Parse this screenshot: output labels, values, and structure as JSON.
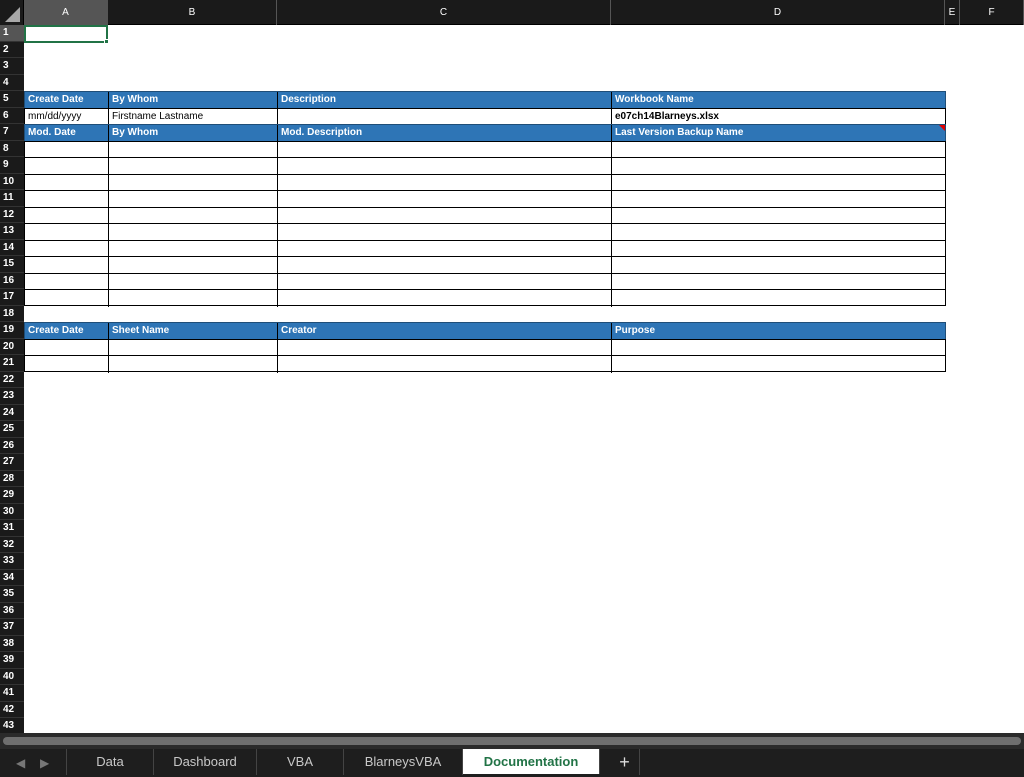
{
  "columns": [
    "A",
    "B",
    "C",
    "D",
    "E",
    "F"
  ],
  "rows": [
    "1",
    "2",
    "3",
    "4",
    "5",
    "6",
    "7",
    "8",
    "9",
    "10",
    "11",
    "12",
    "13",
    "14",
    "15",
    "16",
    "17",
    "18",
    "19",
    "20",
    "21",
    "22",
    "23",
    "24",
    "25",
    "26",
    "27",
    "28",
    "29",
    "30",
    "31",
    "32",
    "33",
    "34",
    "35",
    "36",
    "37",
    "38",
    "39",
    "40",
    "41",
    "42",
    "43"
  ],
  "selected_cell": "A1",
  "table1": {
    "header1": [
      "Create Date",
      "By Whom",
      "Description",
      "Workbook Name"
    ],
    "values1": [
      "mm/dd/yyyy",
      "Firstname Lastname",
      "",
      "e07ch14Blarneys.xlsx"
    ],
    "header2": [
      "Mod. Date",
      "By Whom",
      "Mod. Description",
      "Last Version Backup Name"
    ]
  },
  "table2": {
    "header": [
      "Create Date",
      "Sheet Name",
      "Creator",
      "Purpose"
    ]
  },
  "tabs": [
    "Data",
    "Dashboard",
    "VBA",
    "BlarneysVBA",
    "Documentation"
  ],
  "active_tab": "Documentation",
  "icons": {
    "prev": "chevron-left-icon",
    "next": "chevron-right-icon",
    "add": "plus-icon"
  },
  "colors": {
    "header_blue": "#2e75b6",
    "accent_green": "#217346",
    "comment_red": "#e00000"
  }
}
